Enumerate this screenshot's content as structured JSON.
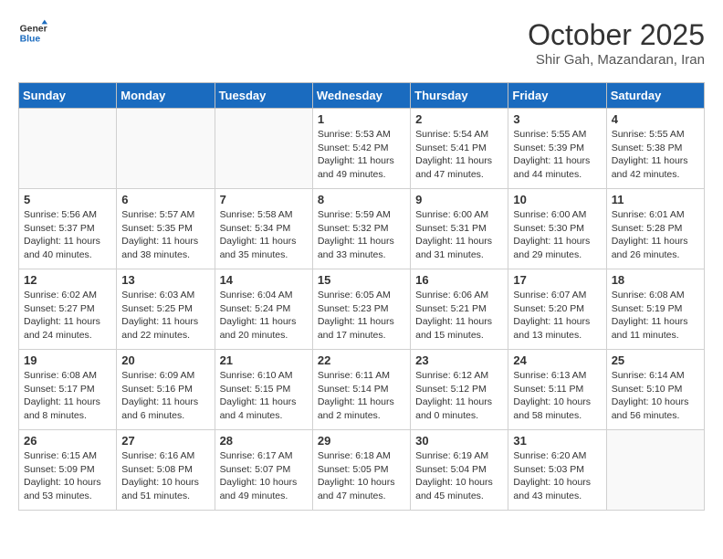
{
  "logo": {
    "text_general": "General",
    "text_blue": "Blue"
  },
  "header": {
    "month_title": "October 2025",
    "subtitle": "Shir Gah, Mazandaran, Iran"
  },
  "days_of_week": [
    "Sunday",
    "Monday",
    "Tuesday",
    "Wednesday",
    "Thursday",
    "Friday",
    "Saturday"
  ],
  "weeks": [
    [
      {
        "day": "",
        "text": ""
      },
      {
        "day": "",
        "text": ""
      },
      {
        "day": "",
        "text": ""
      },
      {
        "day": "1",
        "text": "Sunrise: 5:53 AM\nSunset: 5:42 PM\nDaylight: 11 hours and 49 minutes."
      },
      {
        "day": "2",
        "text": "Sunrise: 5:54 AM\nSunset: 5:41 PM\nDaylight: 11 hours and 47 minutes."
      },
      {
        "day": "3",
        "text": "Sunrise: 5:55 AM\nSunset: 5:39 PM\nDaylight: 11 hours and 44 minutes."
      },
      {
        "day": "4",
        "text": "Sunrise: 5:55 AM\nSunset: 5:38 PM\nDaylight: 11 hours and 42 minutes."
      }
    ],
    [
      {
        "day": "5",
        "text": "Sunrise: 5:56 AM\nSunset: 5:37 PM\nDaylight: 11 hours and 40 minutes."
      },
      {
        "day": "6",
        "text": "Sunrise: 5:57 AM\nSunset: 5:35 PM\nDaylight: 11 hours and 38 minutes."
      },
      {
        "day": "7",
        "text": "Sunrise: 5:58 AM\nSunset: 5:34 PM\nDaylight: 11 hours and 35 minutes."
      },
      {
        "day": "8",
        "text": "Sunrise: 5:59 AM\nSunset: 5:32 PM\nDaylight: 11 hours and 33 minutes."
      },
      {
        "day": "9",
        "text": "Sunrise: 6:00 AM\nSunset: 5:31 PM\nDaylight: 11 hours and 31 minutes."
      },
      {
        "day": "10",
        "text": "Sunrise: 6:00 AM\nSunset: 5:30 PM\nDaylight: 11 hours and 29 minutes."
      },
      {
        "day": "11",
        "text": "Sunrise: 6:01 AM\nSunset: 5:28 PM\nDaylight: 11 hours and 26 minutes."
      }
    ],
    [
      {
        "day": "12",
        "text": "Sunrise: 6:02 AM\nSunset: 5:27 PM\nDaylight: 11 hours and 24 minutes."
      },
      {
        "day": "13",
        "text": "Sunrise: 6:03 AM\nSunset: 5:25 PM\nDaylight: 11 hours and 22 minutes."
      },
      {
        "day": "14",
        "text": "Sunrise: 6:04 AM\nSunset: 5:24 PM\nDaylight: 11 hours and 20 minutes."
      },
      {
        "day": "15",
        "text": "Sunrise: 6:05 AM\nSunset: 5:23 PM\nDaylight: 11 hours and 17 minutes."
      },
      {
        "day": "16",
        "text": "Sunrise: 6:06 AM\nSunset: 5:21 PM\nDaylight: 11 hours and 15 minutes."
      },
      {
        "day": "17",
        "text": "Sunrise: 6:07 AM\nSunset: 5:20 PM\nDaylight: 11 hours and 13 minutes."
      },
      {
        "day": "18",
        "text": "Sunrise: 6:08 AM\nSunset: 5:19 PM\nDaylight: 11 hours and 11 minutes."
      }
    ],
    [
      {
        "day": "19",
        "text": "Sunrise: 6:08 AM\nSunset: 5:17 PM\nDaylight: 11 hours and 8 minutes."
      },
      {
        "day": "20",
        "text": "Sunrise: 6:09 AM\nSunset: 5:16 PM\nDaylight: 11 hours and 6 minutes."
      },
      {
        "day": "21",
        "text": "Sunrise: 6:10 AM\nSunset: 5:15 PM\nDaylight: 11 hours and 4 minutes."
      },
      {
        "day": "22",
        "text": "Sunrise: 6:11 AM\nSunset: 5:14 PM\nDaylight: 11 hours and 2 minutes."
      },
      {
        "day": "23",
        "text": "Sunrise: 6:12 AM\nSunset: 5:12 PM\nDaylight: 11 hours and 0 minutes."
      },
      {
        "day": "24",
        "text": "Sunrise: 6:13 AM\nSunset: 5:11 PM\nDaylight: 10 hours and 58 minutes."
      },
      {
        "day": "25",
        "text": "Sunrise: 6:14 AM\nSunset: 5:10 PM\nDaylight: 10 hours and 56 minutes."
      }
    ],
    [
      {
        "day": "26",
        "text": "Sunrise: 6:15 AM\nSunset: 5:09 PM\nDaylight: 10 hours and 53 minutes."
      },
      {
        "day": "27",
        "text": "Sunrise: 6:16 AM\nSunset: 5:08 PM\nDaylight: 10 hours and 51 minutes."
      },
      {
        "day": "28",
        "text": "Sunrise: 6:17 AM\nSunset: 5:07 PM\nDaylight: 10 hours and 49 minutes."
      },
      {
        "day": "29",
        "text": "Sunrise: 6:18 AM\nSunset: 5:05 PM\nDaylight: 10 hours and 47 minutes."
      },
      {
        "day": "30",
        "text": "Sunrise: 6:19 AM\nSunset: 5:04 PM\nDaylight: 10 hours and 45 minutes."
      },
      {
        "day": "31",
        "text": "Sunrise: 6:20 AM\nSunset: 5:03 PM\nDaylight: 10 hours and 43 minutes."
      },
      {
        "day": "",
        "text": ""
      }
    ]
  ]
}
